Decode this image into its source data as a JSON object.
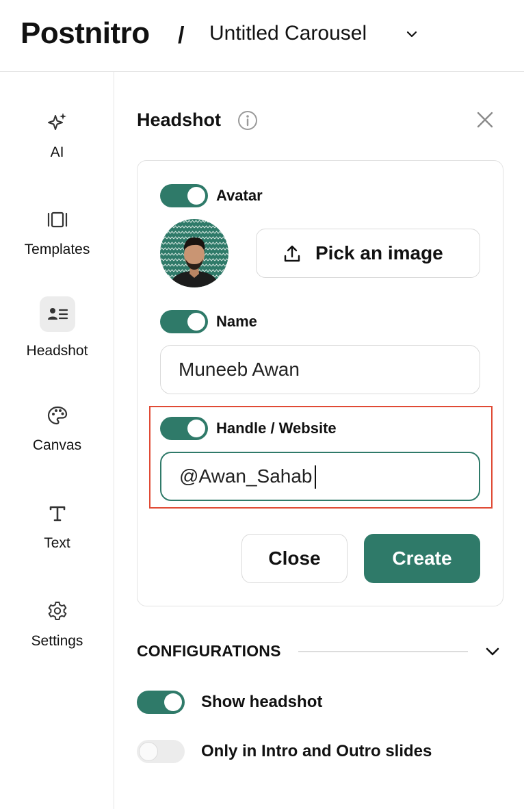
{
  "header": {
    "logo": "Postnitro",
    "separator": "/",
    "document_title": "Untitled Carousel"
  },
  "sidebar": {
    "items": [
      {
        "label": "AI",
        "icon": "sparkles-icon"
      },
      {
        "label": "Templates",
        "icon": "templates-icon"
      },
      {
        "label": "Headshot",
        "icon": "id-card-icon",
        "active": true
      },
      {
        "label": "Canvas",
        "icon": "palette-icon"
      },
      {
        "label": "Text",
        "icon": "text-t-icon"
      },
      {
        "label": "Settings",
        "icon": "gear-icon"
      }
    ]
  },
  "panel": {
    "title": "Headshot"
  },
  "form": {
    "avatar": {
      "label": "Avatar",
      "enabled": true
    },
    "pick_image_label": "Pick an image",
    "name": {
      "label": "Name",
      "enabled": true,
      "value": "Muneeb Awan"
    },
    "handle": {
      "label": "Handle / Website",
      "enabled": true,
      "value": "@Awan_Sahab"
    },
    "close_label": "Close",
    "create_label": "Create"
  },
  "configurations": {
    "title": "CONFIGURATIONS",
    "options": [
      {
        "label": "Show headshot",
        "enabled": true
      },
      {
        "label": "Only in Intro and Outro slides",
        "enabled": false
      }
    ]
  },
  "colors": {
    "accent": "#2f7a69",
    "highlight": "#e04a35"
  }
}
